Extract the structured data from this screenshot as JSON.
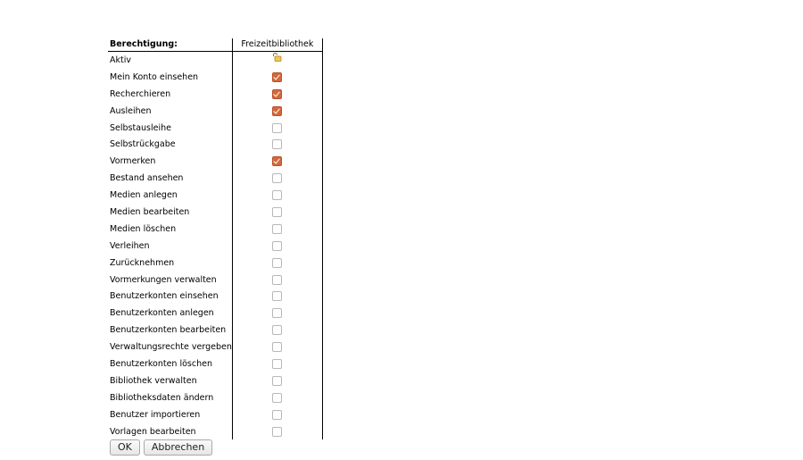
{
  "table": {
    "header": {
      "permission_label": "Berechtigung:",
      "library_label": "Freizeitbibliothek"
    },
    "rows": [
      {
        "label": "Aktiv",
        "state": "icon",
        "icon": "unlock-icon"
      },
      {
        "label": "Mein Konto einsehen",
        "state": "checked"
      },
      {
        "label": "Recherchieren",
        "state": "checked"
      },
      {
        "label": "Ausleihen",
        "state": "checked"
      },
      {
        "label": "Selbstausleihe",
        "state": "unchecked"
      },
      {
        "label": "Selbstrückgabe",
        "state": "unchecked"
      },
      {
        "label": "Vormerken",
        "state": "checked"
      },
      {
        "label": "Bestand ansehen",
        "state": "unchecked"
      },
      {
        "label": "Medien anlegen",
        "state": "unchecked"
      },
      {
        "label": "Medien bearbeiten",
        "state": "unchecked"
      },
      {
        "label": "Medien löschen",
        "state": "unchecked"
      },
      {
        "label": "Verleihen",
        "state": "unchecked"
      },
      {
        "label": "Zurücknehmen",
        "state": "unchecked"
      },
      {
        "label": "Vormerkungen verwalten",
        "state": "unchecked"
      },
      {
        "label": "Benutzerkonten einsehen",
        "state": "unchecked"
      },
      {
        "label": "Benutzerkonten anlegen",
        "state": "unchecked"
      },
      {
        "label": "Benutzerkonten bearbeiten",
        "state": "unchecked"
      },
      {
        "label": "Verwaltungsrechte vergeben",
        "state": "unchecked"
      },
      {
        "label": "Benutzerkonten löschen",
        "state": "unchecked"
      },
      {
        "label": "Bibliothek verwalten",
        "state": "unchecked"
      },
      {
        "label": "Bibliotheksdaten ändern",
        "state": "unchecked"
      },
      {
        "label": "Benutzer importieren",
        "state": "unchecked"
      },
      {
        "label": "Vorlagen bearbeiten",
        "state": "unchecked"
      }
    ]
  },
  "buttons": {
    "ok_label": "OK",
    "cancel_label": "Abbrechen"
  },
  "colors": {
    "checkbox_checked": "#d4693a",
    "lock_icon": "#f2c94c"
  }
}
